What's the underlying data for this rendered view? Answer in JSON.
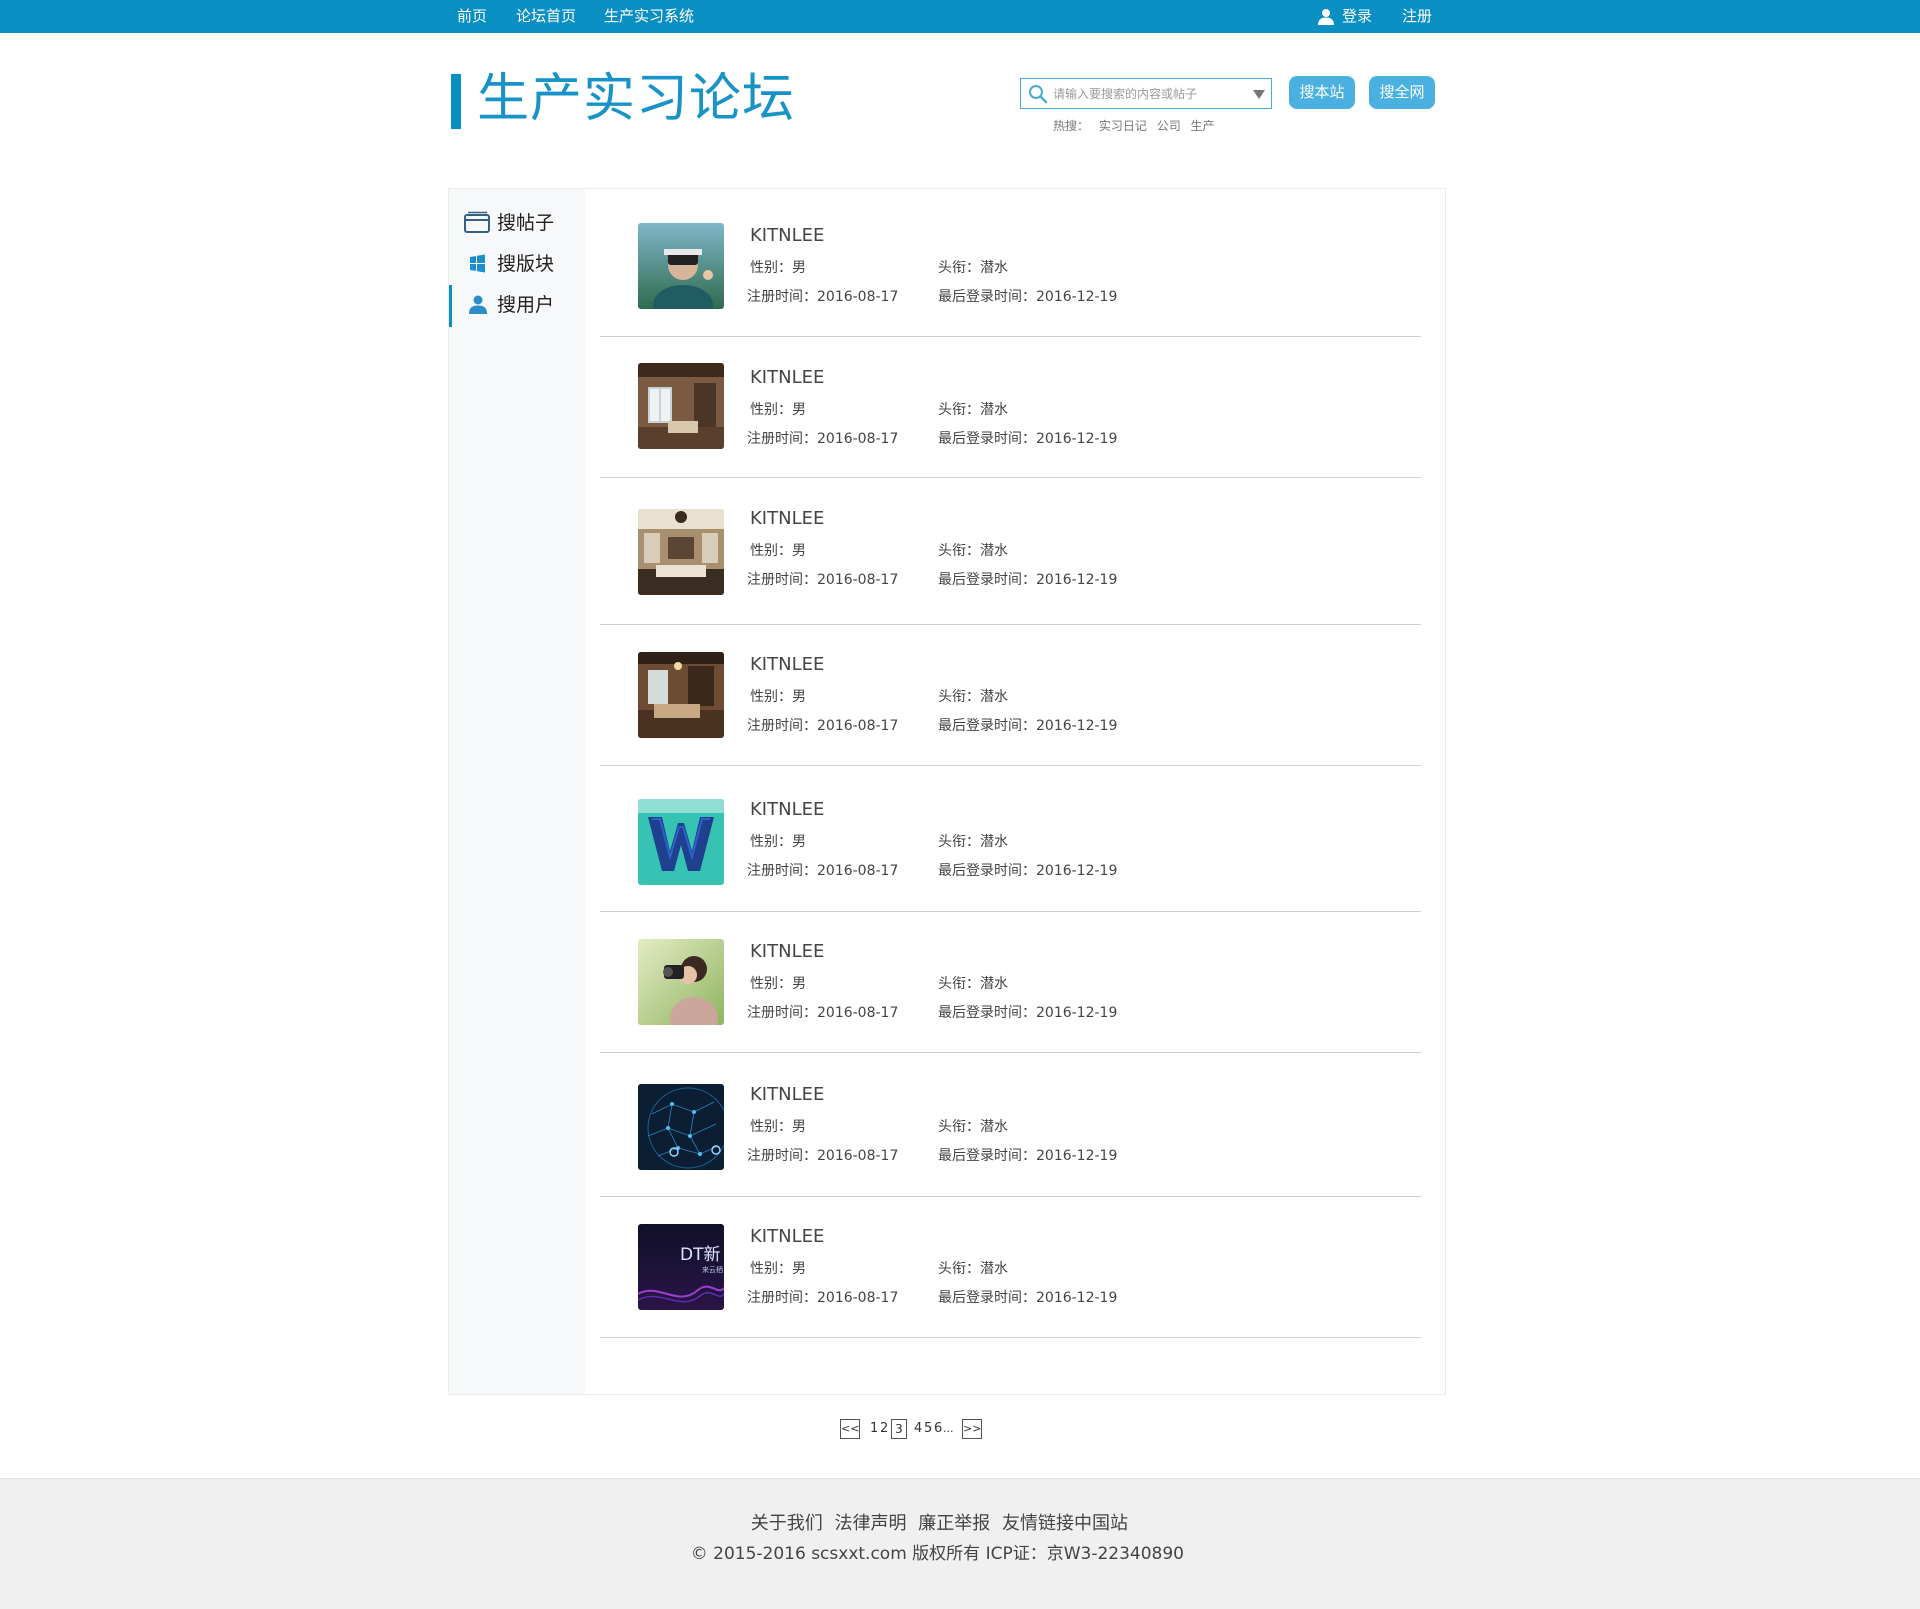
{
  "topnav": {
    "items": [
      "前页",
      "论坛首页",
      "生产实习系统"
    ],
    "login": "登录",
    "register": "注册"
  },
  "header": {
    "title": "生产实习论坛",
    "search_placeholder": "请输入要搜索的内容或帖子",
    "btn_site": "搜本站",
    "btn_web": "搜全网",
    "hot_label": "热搜：",
    "hot_tags": [
      "实习日记",
      "公司",
      "生产"
    ]
  },
  "sidebar": {
    "items": [
      {
        "label": "搜帖子",
        "icon": "card-icon"
      },
      {
        "label": "搜版块",
        "icon": "windows-icon"
      },
      {
        "label": "搜用户",
        "icon": "user-icon"
      }
    ],
    "active_index": 2
  },
  "users": [
    {
      "name": "KITNLEE",
      "gender": "性别：男",
      "title": "头衔：潜水",
      "reg": "注册时间：2016-08-17",
      "last": "最后登录时间：2016-12-19",
      "avatar": "vr-headset-person"
    },
    {
      "name": "KITNLEE",
      "gender": "性别：男",
      "title": "头衔：潜水",
      "reg": "注册时间：2016-08-17",
      "last": "最后登录时间：2016-12-19",
      "avatar": "interior-room"
    },
    {
      "name": "KITNLEE",
      "gender": "性别：男",
      "title": "头衔：潜水",
      "reg": "注册时间：2016-08-17",
      "last": "最后登录时间：2016-12-19",
      "avatar": "living-room"
    },
    {
      "name": "KITNLEE",
      "gender": "性别：男",
      "title": "头衔：潜水",
      "reg": "注册时间：2016-08-17",
      "last": "最后登录时间：2016-12-19",
      "avatar": "interior-room-2"
    },
    {
      "name": "KITNLEE",
      "gender": "性别：男",
      "title": "头衔：潜水",
      "reg": "注册时间：2016-08-17",
      "last": "最后登录时间：2016-12-19",
      "avatar": "w-logo"
    },
    {
      "name": "KITNLEE",
      "gender": "性别：男",
      "title": "头衔：潜水",
      "reg": "注册时间：2016-08-17",
      "last": "最后登录时间：2016-12-19",
      "avatar": "photographer"
    },
    {
      "name": "KITNLEE",
      "gender": "性别：男",
      "title": "头衔：潜水",
      "reg": "注册时间：2016-08-17",
      "last": "最后登录时间：2016-12-19",
      "avatar": "network-globe"
    },
    {
      "name": "KITNLEE",
      "gender": "性别：男",
      "title": "头衔：潜水",
      "reg": "注册时间：2016-08-17",
      "last": "最后登录时间：2016-12-19",
      "avatar": "dt-banner",
      "avatar_text": "DT新",
      "avatar_subtext": "来云栖"
    }
  ],
  "pagination": {
    "prev": "<<",
    "pages": [
      "1",
      "2",
      "3",
      "4",
      "5",
      "6"
    ],
    "current": "3",
    "ellipsis": "...",
    "next": ">>"
  },
  "footer": {
    "links": [
      "关于我们",
      "法律声明",
      "廉正举报",
      "友情链接中国站"
    ],
    "copyright": "© 2015-2016 scsxxt.com 版权所有 ICP证：京W3-22340890"
  },
  "colors": {
    "primary": "#0a8fc3",
    "title": "#1793c8",
    "pill": "#4ab0e0"
  }
}
